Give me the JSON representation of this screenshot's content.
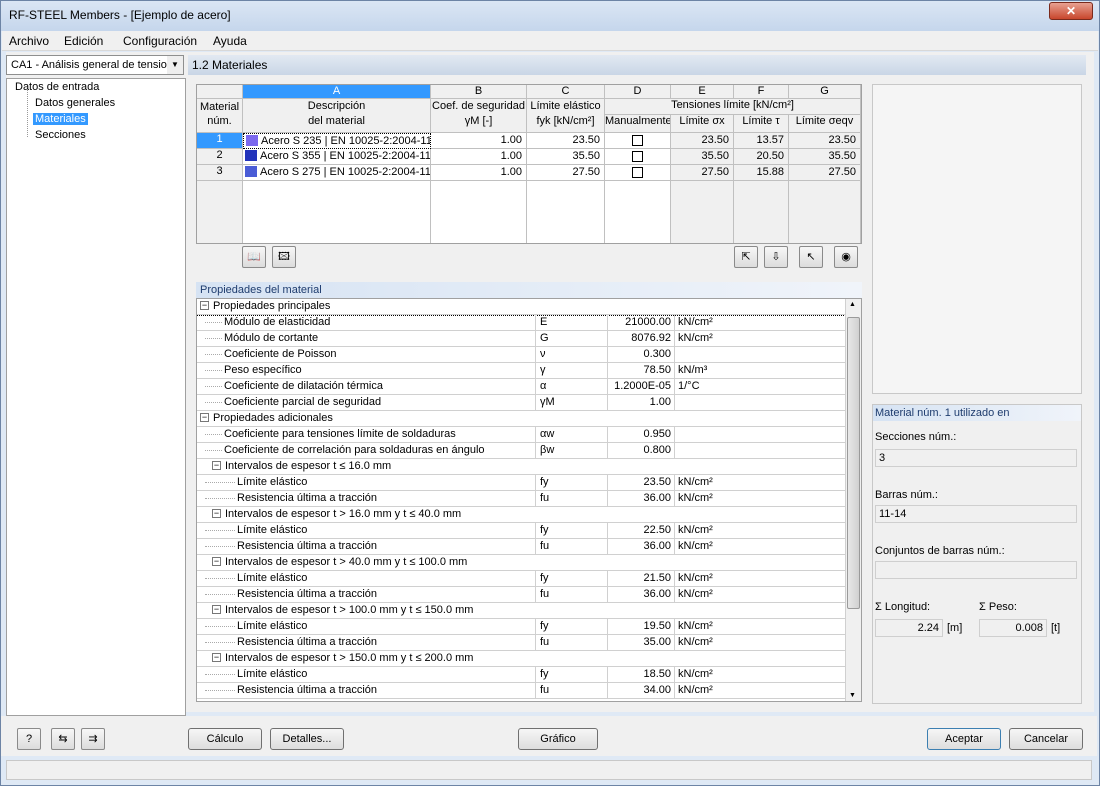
{
  "window": {
    "title": "RF-STEEL Members - [Ejemplo de acero]",
    "close": "✕"
  },
  "menu": [
    "Archivo",
    "Edición",
    "Configuración",
    "Ayuda"
  ],
  "nav": {
    "case_select": "CA1 - Análisis general de tension",
    "root": "Datos de entrada",
    "items": [
      "Datos generales",
      "Materiales",
      "Secciones"
    ],
    "selected": "Materiales"
  },
  "section_title": "1.2 Materiales",
  "grid": {
    "col_letters": [
      "A",
      "B",
      "C",
      "D",
      "E",
      "F",
      "G"
    ],
    "hdr_num": "Material\nnúm.",
    "hdr_desc1": "Descripción",
    "hdr_desc2": "del material",
    "hdr_safety1": "Coef. de seguridad",
    "hdr_safety2": "γM [-]",
    "hdr_yield1": "Límite elástico",
    "hdr_yield2": "fyk [kN/cm²]",
    "hdr_limits": "Tensiones límite [kN/cm²]",
    "hdr_manual": "Manualmente",
    "hdr_sx": "Límite σx",
    "hdr_tau": "Límite τ",
    "hdr_seqv": "Límite σeqv",
    "rows": [
      {
        "num": "1",
        "desc": "Acero S 235 | EN 10025-2:2004-11",
        "color": "#7b68ee",
        "gm": "1.00",
        "fyk": "23.50",
        "sx": "23.50",
        "tau": "13.57",
        "seqv": "23.50"
      },
      {
        "num": "2",
        "desc": "Acero S 355 | EN 10025-2:2004-11",
        "color": "#2233bb",
        "gm": "1.00",
        "fyk": "35.50",
        "sx": "35.50",
        "tau": "20.50",
        "seqv": "35.50"
      },
      {
        "num": "3",
        "desc": "Acero S 275 | EN 10025-2:2004-11",
        "color": "#4a5cd6",
        "gm": "1.00",
        "fyk": "27.50",
        "sx": "27.50",
        "tau": "15.88",
        "seqv": "27.50"
      }
    ]
  },
  "props": {
    "header": "Propiedades del material",
    "rows": [
      {
        "t": "g",
        "label": "Propiedades principales"
      },
      {
        "t": "p",
        "label": "Módulo de elasticidad",
        "sym": "E",
        "val": "21000.00",
        "unit": "kN/cm²"
      },
      {
        "t": "p",
        "label": "Módulo de cortante",
        "sym": "G",
        "val": "8076.92",
        "unit": "kN/cm²"
      },
      {
        "t": "p",
        "label": "Coeficiente de Poisson",
        "sym": "ν",
        "val": "0.300",
        "unit": ""
      },
      {
        "t": "p",
        "label": "Peso específico",
        "sym": "γ",
        "val": "78.50",
        "unit": "kN/m³"
      },
      {
        "t": "p",
        "label": "Coeficiente de dilatación térmica",
        "sym": "α",
        "val": "1.2000E-05",
        "unit": "1/°C"
      },
      {
        "t": "p",
        "label": "Coeficiente parcial de seguridad",
        "sym": "γM",
        "val": "1.00",
        "unit": ""
      },
      {
        "t": "g",
        "label": "Propiedades adicionales"
      },
      {
        "t": "p",
        "label": "Coeficiente para tensiones límite de soldaduras",
        "sym": "αw",
        "val": "0.950",
        "unit": ""
      },
      {
        "t": "p",
        "label": "Coeficiente de correlación para soldaduras en ángulo",
        "sym": "βw",
        "val": "0.800",
        "unit": ""
      },
      {
        "t": "s",
        "label": "Intervalos de espesor t ≤ 16.0 mm"
      },
      {
        "t": "q",
        "label": "Límite elástico",
        "sym": "fy",
        "val": "23.50",
        "unit": "kN/cm²"
      },
      {
        "t": "q",
        "label": "Resistencia última a tracción",
        "sym": "fu",
        "val": "36.00",
        "unit": "kN/cm²"
      },
      {
        "t": "s",
        "label": "Intervalos de espesor t > 16.0 mm y t ≤ 40.0 mm"
      },
      {
        "t": "q",
        "label": "Límite elástico",
        "sym": "fy",
        "val": "22.50",
        "unit": "kN/cm²"
      },
      {
        "t": "q",
        "label": "Resistencia última a tracción",
        "sym": "fu",
        "val": "36.00",
        "unit": "kN/cm²"
      },
      {
        "t": "s",
        "label": "Intervalos de espesor t > 40.0 mm y t ≤ 100.0 mm"
      },
      {
        "t": "q",
        "label": "Límite elástico",
        "sym": "fy",
        "val": "21.50",
        "unit": "kN/cm²"
      },
      {
        "t": "q",
        "label": "Resistencia última a tracción",
        "sym": "fu",
        "val": "36.00",
        "unit": "kN/cm²"
      },
      {
        "t": "s",
        "label": "Intervalos de espesor t > 100.0 mm y t ≤ 150.0 mm"
      },
      {
        "t": "q",
        "label": "Límite elástico",
        "sym": "fy",
        "val": "19.50",
        "unit": "kN/cm²"
      },
      {
        "t": "q",
        "label": "Resistencia última a tracción",
        "sym": "fu",
        "val": "35.00",
        "unit": "kN/cm²"
      },
      {
        "t": "s",
        "label": "Intervalos de espesor t > 150.0 mm y t ≤ 200.0 mm"
      },
      {
        "t": "q",
        "label": "Límite elástico",
        "sym": "fy",
        "val": "18.50",
        "unit": "kN/cm²"
      },
      {
        "t": "q",
        "label": "Resistencia última a tracción",
        "sym": "fu",
        "val": "34.00",
        "unit": "kN/cm²"
      }
    ]
  },
  "usage": {
    "header": "Material núm. 1 utilizado en",
    "sections_label": "Secciones núm.:",
    "sections_val": "3",
    "members_label": "Barras núm.:",
    "members_val": "11-14",
    "sets_label": "Conjuntos de barras núm.:",
    "sets_val": "",
    "length_label": "Σ Longitud:",
    "length_val": "2.24",
    "length_unit": "[m]",
    "weight_label": "Σ Peso:",
    "weight_val": "0.008",
    "weight_unit": "[t]"
  },
  "buttons": {
    "calc": "Cálculo",
    "details": "Detalles...",
    "graphic": "Gráfico",
    "ok": "Aceptar",
    "cancel": "Cancelar"
  }
}
